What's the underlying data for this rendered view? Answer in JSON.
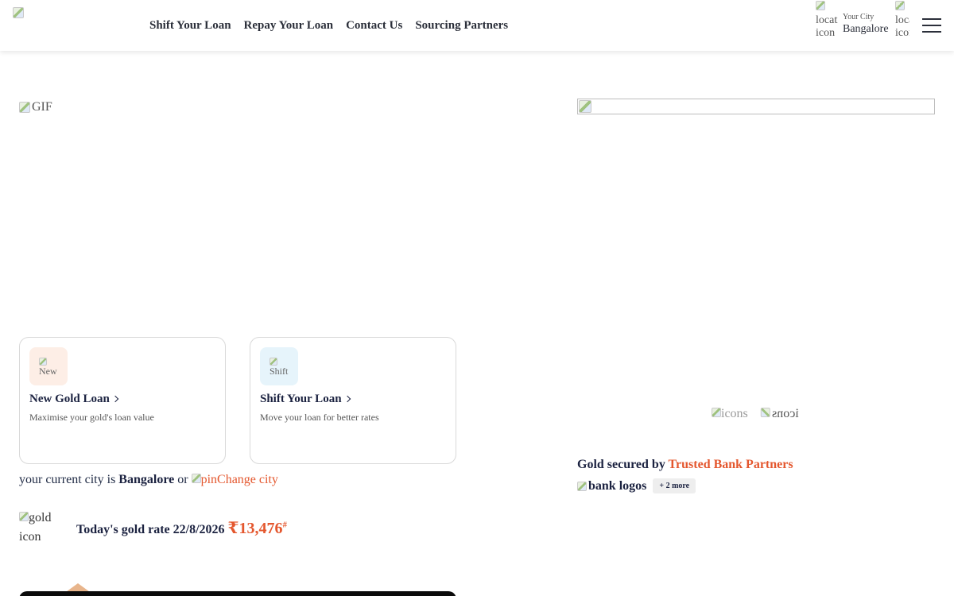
{
  "header": {
    "nav": [
      "Shift Your Loan",
      "Repay Your Loan",
      "Contact Us",
      "Sourcing Partners"
    ],
    "location_icon_alt": "location icon",
    "city_label": "Your City",
    "city_name": "Bangalore",
    "locate_icon_alt": "location icon"
  },
  "hero": {
    "gif_alt": "GIF"
  },
  "cards": [
    {
      "icon_alt": "New Gold Loan",
      "title": "New Gold Loan",
      "subtitle": "Maximise your gold's loan value",
      "icon_bg": "#fdeee6"
    },
    {
      "icon_alt": "Shift Your Loan",
      "title": "Shift Your Loan",
      "subtitle": "Move your loan for better rates",
      "icon_bg": "#e6f4fb"
    }
  ],
  "city_line": {
    "prefix": "your current city is",
    "city": "Bangalore",
    "or": "or",
    "pin_alt": "pin",
    "change": "Change city"
  },
  "gold_rate": {
    "icon_alt": "gold icon",
    "label": "Today's gold rate 22/8/2026",
    "price": "₹13,476",
    "footnote": "#"
  },
  "right": {
    "icons_alt_1": "icons",
    "icons_alt_2": "icons",
    "trust_prefix": "Gold secured by",
    "trust_accent": "Trusted Bank Partners",
    "bank_logos_alt": "bank logos",
    "more_chip": "+ 2 more"
  },
  "colors": {
    "accent": "#e4572e",
    "navy": "#1b2240"
  }
}
